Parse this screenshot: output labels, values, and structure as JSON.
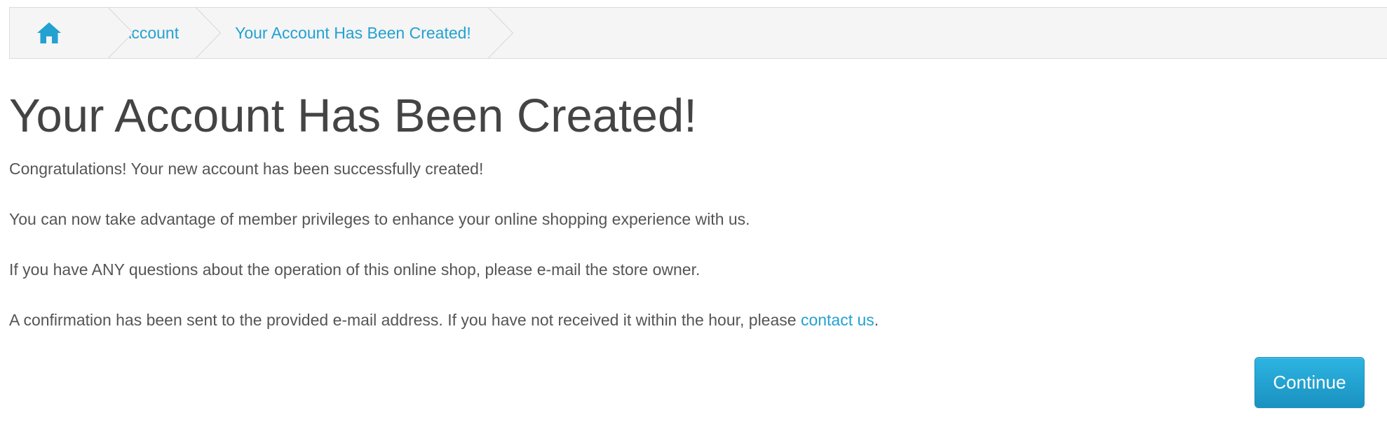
{
  "breadcrumb": {
    "home_icon": "home-icon",
    "items": [
      {
        "label": "Account"
      },
      {
        "label": "Your Account Has Been Created!"
      }
    ]
  },
  "page": {
    "title": "Your Account Has Been Created!",
    "paragraphs": [
      "Congratulations! Your new account has been successfully created!",
      "You can now take advantage of member privileges to enhance your online shopping experience with us.",
      "If you have ANY questions about the operation of this online shop, please e-mail the store owner."
    ],
    "confirmation_text": "A confirmation has been sent to the provided e-mail address. If you have not received it within the hour, please ",
    "contact_link": "contact us",
    "confirmation_end": "."
  },
  "actions": {
    "continue_label": "Continue"
  },
  "colors": {
    "link": "#23a1d1",
    "button": "#1fa0d0",
    "heading": "#444444",
    "text": "#555555",
    "breadcrumb_bg": "#f5f5f5"
  }
}
